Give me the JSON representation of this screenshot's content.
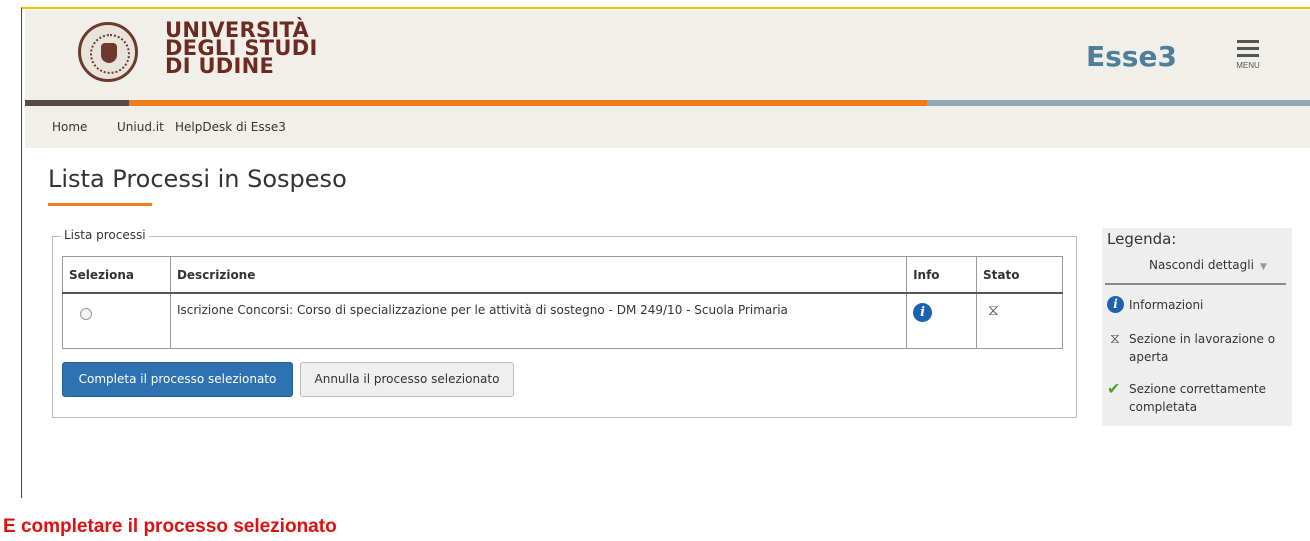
{
  "header": {
    "university_lines": [
      "UNIVERSITÀ",
      "DEGLI STUDI",
      "DI UDINE"
    ],
    "app_name": "Esse3",
    "menu_label": "MENU",
    "menu_icon": "hamburger-icon"
  },
  "nav": {
    "links": [
      {
        "label": "Home"
      },
      {
        "label": "Uniud.it"
      },
      {
        "label": "HelpDesk di Esse3"
      }
    ]
  },
  "page": {
    "title": "Lista Processi in Sospeso"
  },
  "process_list": {
    "legend": "Lista processi",
    "columns": [
      "Seleziona",
      "Descrizione",
      "Info",
      "Stato"
    ],
    "rows": [
      {
        "selected": false,
        "description": "Iscrizione Concorsi: Corso di specializzazione per le attività di sostegno - DM 249/10 - Scuola Primaria",
        "info_icon": "info-icon",
        "status_icon": "hourglass-icon"
      }
    ],
    "buttons": {
      "complete": "Completa il processo selezionato",
      "cancel": "Annulla il processo selezionato"
    }
  },
  "legend_panel": {
    "title": "Legenda:",
    "toggle": "Nascondi dettagli",
    "items": [
      {
        "icon": "info-icon",
        "label": "Informazioni"
      },
      {
        "icon": "hourglass-icon",
        "label": "Sezione in lavorazione o aperta"
      },
      {
        "icon": "checkmark-icon",
        "label": "Sezione correttamente completata"
      }
    ]
  },
  "caption": "E completare il processo selezionato",
  "colors": {
    "brand_brown": "#6d2b1f",
    "brand_blue": "#4f7e9a",
    "accent_orange": "#f07a1c",
    "primary_button": "#2f72b2",
    "caption_red": "#e01010"
  }
}
